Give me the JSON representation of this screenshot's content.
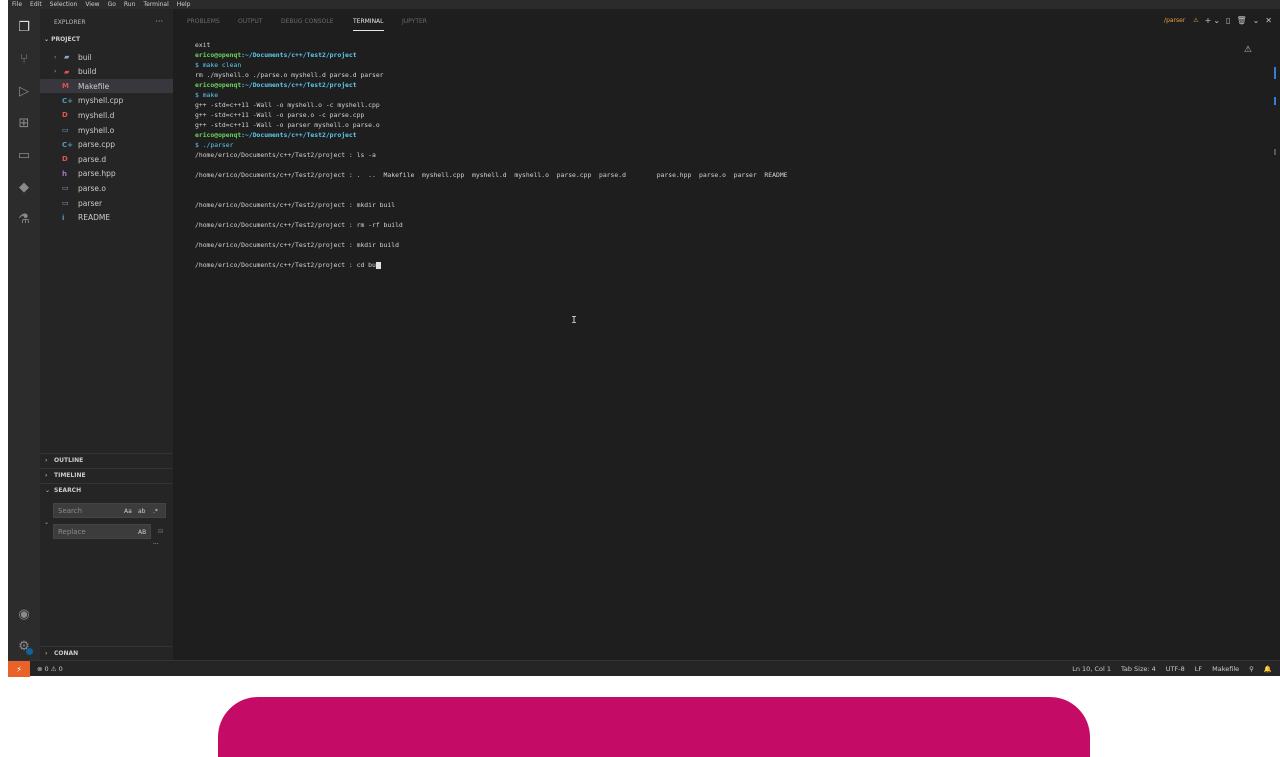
{
  "menu": [
    "File",
    "Edit",
    "Selection",
    "View",
    "Go",
    "Run",
    "Terminal",
    "Help"
  ],
  "activity_icons": [
    "files-icon",
    "source-control-icon",
    "run-debug-icon",
    "extensions-icon",
    "remote-explorer-icon",
    "docker-icon",
    "testing-icon",
    "account-icon",
    "settings-gear-icon"
  ],
  "sidebar": {
    "title": "EXPLORER",
    "more": "···",
    "project": "PROJECT",
    "tree": [
      {
        "label": "buil",
        "kind": "folder",
        "icon": "▰",
        "color": "#8fa8c8"
      },
      {
        "label": "build",
        "kind": "folder-red",
        "icon": "▰",
        "color": "#e05252"
      },
      {
        "label": "Makefile",
        "kind": "file",
        "icon": "M",
        "color": "#e05252"
      },
      {
        "label": "myshell.cpp",
        "kind": "file",
        "icon": "C+",
        "color": "#519aba"
      },
      {
        "label": "myshell.d",
        "kind": "file",
        "icon": "D",
        "color": "#e05252"
      },
      {
        "label": "myshell.o",
        "kind": "file",
        "icon": "▭",
        "color": "#7aa2d8"
      },
      {
        "label": "parse.cpp",
        "kind": "file",
        "icon": "C+",
        "color": "#519aba"
      },
      {
        "label": "parse.d",
        "kind": "file",
        "icon": "D",
        "color": "#e05252"
      },
      {
        "label": "parse.hpp",
        "kind": "file",
        "icon": "h",
        "color": "#a074c4"
      },
      {
        "label": "parse.o",
        "kind": "file",
        "icon": "▭",
        "color": "#7aa2d8"
      },
      {
        "label": "parser",
        "kind": "file",
        "icon": "▭",
        "color": "#7aa2d8"
      },
      {
        "label": "README",
        "kind": "file",
        "icon": "i",
        "color": "#519aba"
      }
    ],
    "sections": {
      "outline": "OUTLINE",
      "timeline": "TIMELINE",
      "search": "SEARCH",
      "conan": "CONAN"
    },
    "search": {
      "placeholder": "Search",
      "replace_placeholder": "Replace",
      "case_opt": "Aa",
      "word_opt": "ab",
      "regex_opt": ".*",
      "preserve_case": "AB",
      "replace_all": "⊟",
      "more": "···"
    }
  },
  "panel": {
    "tabs": [
      "PROBLEMS",
      "OUTPUT",
      "DEBUG CONSOLE",
      "TERMINAL",
      "JUPYTER"
    ],
    "active_tab": "TERMINAL",
    "terminal_name": "/parser",
    "tools": {
      "add": "+",
      "add_menu": "⌄",
      "split": "▯",
      "kill": "🗑",
      "chevron": "⌄",
      "close": "✕"
    },
    "warn_icon": "⚠"
  },
  "terminal": {
    "lines": [
      {
        "type": "text",
        "text": "exit"
      },
      {
        "type": "prompt",
        "user": "erico@openqt",
        "path": ":~/Documents/c++/Test2/project"
      },
      {
        "type": "cmd",
        "text": "$ make clean"
      },
      {
        "type": "text",
        "text": "rm ./myshell.o ./parse.o myshell.d parse.d parser"
      },
      {
        "type": "prompt",
        "user": "erico@openqt",
        "path": ":~/Documents/c++/Test2/project"
      },
      {
        "type": "cmd",
        "text": "$ make"
      },
      {
        "type": "text",
        "text": "g++ -std=c++11 -Wall -o myshell.o -c myshell.cpp"
      },
      {
        "type": "text",
        "text": "g++ -std=c++11 -Wall -o parse.o -c parse.cpp"
      },
      {
        "type": "text",
        "text": "g++ -std=c++11 -Wall -o parser myshell.o parse.o"
      },
      {
        "type": "prompt",
        "user": "erico@openqt",
        "path": ":~/Documents/c++/Test2/project"
      },
      {
        "type": "cmd",
        "text": "$ ./parser"
      },
      {
        "type": "text",
        "text": "/home/erico/Documents/c++/Test2/project : ls -a"
      },
      {
        "type": "blank",
        "text": ""
      },
      {
        "type": "text",
        "text": "/home/erico/Documents/c++/Test2/project : .  ..  Makefile  myshell.cpp  myshell.d  myshell.o  parse.cpp  parse.d        parse.hpp  parse.o  parser  README"
      },
      {
        "type": "blank",
        "text": ""
      },
      {
        "type": "blank",
        "text": ""
      },
      {
        "type": "text",
        "text": "/home/erico/Documents/c++/Test2/project : mkdir buil"
      },
      {
        "type": "blank",
        "text": ""
      },
      {
        "type": "text",
        "text": "/home/erico/Documents/c++/Test2/project : rm -rf build"
      },
      {
        "type": "blank",
        "text": ""
      },
      {
        "type": "text",
        "text": "/home/erico/Documents/c++/Test2/project : mkdir build"
      },
      {
        "type": "blank",
        "text": ""
      },
      {
        "type": "current",
        "text": "/home/erico/Documents/c++/Test2/project : cd bu"
      }
    ]
  },
  "status": {
    "remote_icon": "⚡",
    "problems": "⊗ 0 ⚠ 0",
    "right": [
      "Ln 10, Col 1",
      "Tab Size: 4",
      "UTF-8",
      "LF",
      "Makefile",
      "⚲",
      "🔔"
    ]
  },
  "colors": {
    "accent": "#c40b65",
    "remote": "#e8622a"
  }
}
